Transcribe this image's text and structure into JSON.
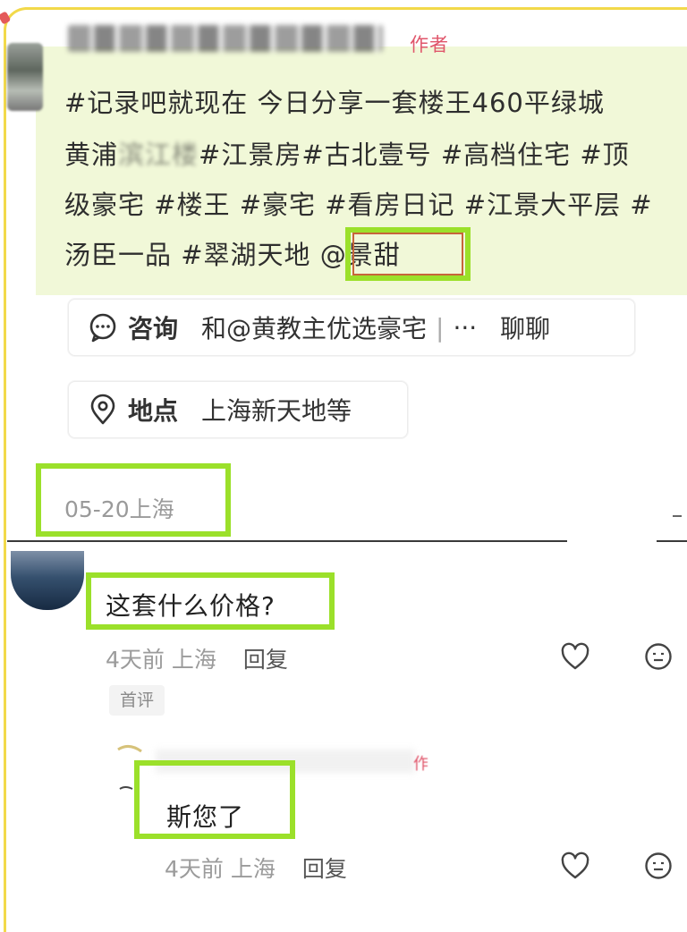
{
  "post": {
    "author_tag": "作者",
    "lines": [
      "#记录吧就现在 今日分享一套楼王460平绿城",
      "#江景房#古北壹号 #高档住宅 #顶",
      "级豪宅 #楼王 #豪宅 #看房日记 #江景大平层 #",
      "汤臣一品 #翠湖天地 "
    ],
    "line2_prefix": "黄浦",
    "line2_blurred": "滨江楼",
    "mention": "@景甜"
  },
  "consult": {
    "label": "咨询",
    "text": "和@黄教主优选豪宅",
    "divider": "|",
    "more": "···",
    "action": "聊聊"
  },
  "location": {
    "label": "地点",
    "text": "上海新天地等"
  },
  "date": "05-20上海",
  "comments": [
    {
      "text": "这套什么价格?",
      "time": "4天前",
      "place": "上海",
      "reply_label": "回复",
      "badge": "首评"
    }
  ],
  "reply": {
    "author_tag": "作者",
    "text": "斯您了",
    "time": "4天前",
    "place": "上海",
    "reply_label": "回复"
  },
  "colors": {
    "highlight_border": "#9be02a",
    "highlight_bg": "#f1f8d8",
    "author_tag": "#e0566b",
    "frame": "#f2d94a"
  },
  "icons": [
    "chat-bubble-icon",
    "location-pin-icon",
    "heart-icon",
    "emoji-face-icon"
  ]
}
